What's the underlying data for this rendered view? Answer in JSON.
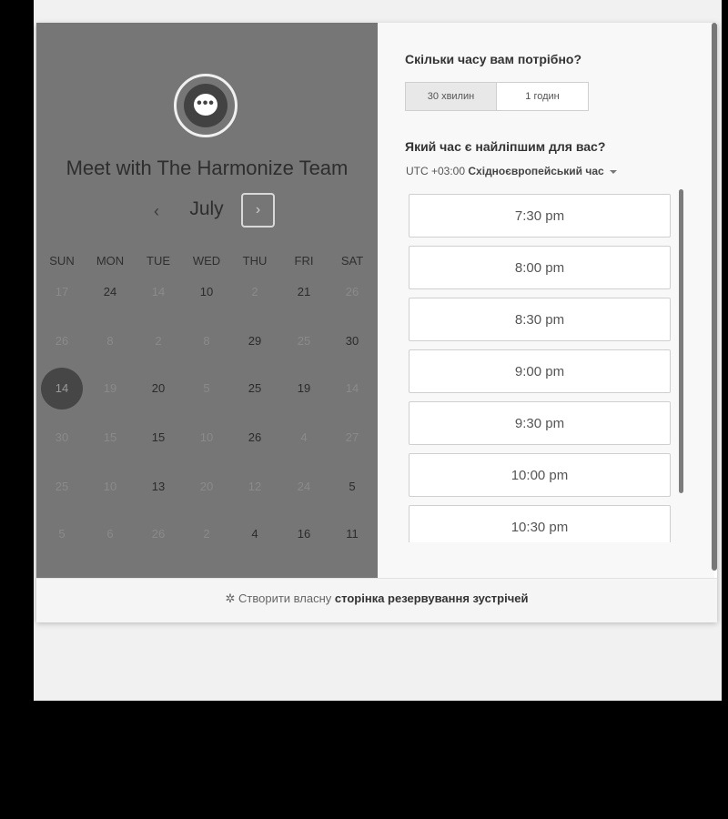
{
  "title": "Meet with The Harmonize Team",
  "calendar": {
    "month": "July",
    "prev_label": "‹",
    "next_label": "›",
    "weekdays": [
      "SUN",
      "MON",
      "TUE",
      "WED",
      "THU",
      "FRI",
      "SAT"
    ],
    "rows": [
      [
        {
          "d": "17",
          "s": "dim"
        },
        {
          "d": "24",
          "s": "act"
        },
        {
          "d": "14",
          "s": "dim"
        },
        {
          "d": "10",
          "s": "act"
        },
        {
          "d": "2",
          "s": "dim"
        },
        {
          "d": "21",
          "s": "act"
        },
        {
          "d": "26",
          "s": "dim"
        }
      ],
      [
        {
          "d": "26",
          "s": "dim"
        },
        {
          "d": "8",
          "s": "dim"
        },
        {
          "d": "2",
          "s": "dim"
        },
        {
          "d": "8",
          "s": "dim"
        },
        {
          "d": "29",
          "s": "act"
        },
        {
          "d": "25",
          "s": "dim"
        },
        {
          "d": "30",
          "s": "act"
        }
      ],
      [
        {
          "d": "14",
          "s": "sel"
        },
        {
          "d": "19",
          "s": "dim"
        },
        {
          "d": "20",
          "s": "act"
        },
        {
          "d": "5",
          "s": "dim"
        },
        {
          "d": "25",
          "s": "act"
        },
        {
          "d": "19",
          "s": "act"
        },
        {
          "d": "14",
          "s": "dim"
        }
      ],
      [
        {
          "d": "30",
          "s": "dim"
        },
        {
          "d": "15",
          "s": "dim"
        },
        {
          "d": "15",
          "s": "act"
        },
        {
          "d": "10",
          "s": "dim"
        },
        {
          "d": "26",
          "s": "act"
        },
        {
          "d": "4",
          "s": "dim"
        },
        {
          "d": "27",
          "s": "dim"
        }
      ],
      [
        {
          "d": "25",
          "s": "dim"
        },
        {
          "d": "10",
          "s": "dim"
        },
        {
          "d": "13",
          "s": "act"
        },
        {
          "d": "20",
          "s": "dim"
        },
        {
          "d": "12",
          "s": "dim"
        },
        {
          "d": "24",
          "s": "dim"
        },
        {
          "d": "5",
          "s": "act"
        }
      ],
      [
        {
          "d": "5",
          "s": "dim"
        },
        {
          "d": "6",
          "s": "dim"
        },
        {
          "d": "26",
          "s": "dim"
        },
        {
          "d": "2",
          "s": "dim"
        },
        {
          "d": "4",
          "s": "act"
        },
        {
          "d": "16",
          "s": "act"
        },
        {
          "d": "11",
          "s": "act"
        }
      ]
    ]
  },
  "booking": {
    "duration_question": "Скільки часу вам потрібно?",
    "durations": [
      "30 хвилин",
      "1 годин"
    ],
    "time_question": "Який час є найліпшим для вас?",
    "timezone_offset": "UTC +03:00",
    "timezone_name": "Східноєвропейський час",
    "slots": [
      "7:30 pm",
      "8:00 pm",
      "8:30 pm",
      "9:00 pm",
      "9:30 pm",
      "10:00 pm",
      "10:30 pm"
    ]
  },
  "footer": {
    "prefix": "Створити власну",
    "link": "сторінка резервування зустрічей"
  }
}
